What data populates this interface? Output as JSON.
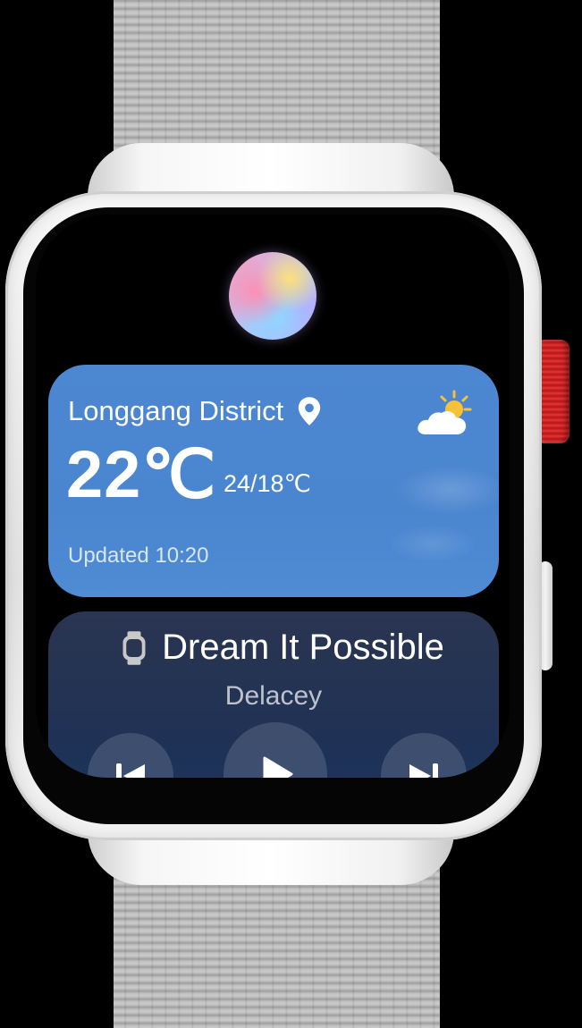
{
  "assistant": {
    "icon": "assistant-orb-icon"
  },
  "weather": {
    "location": "Longgang District",
    "temperature": "22℃",
    "range": "24/18℃",
    "updated": "Updated 10:20",
    "location_icon": "location-pin-icon",
    "condition_icon": "partly-cloudy-icon",
    "card_color": "#4a85cf"
  },
  "music": {
    "title": "Dream It Possible",
    "artist": "Delacey",
    "device_icon": "watch-icon",
    "controls": [
      "previous-track-icon",
      "play-icon",
      "next-track-icon"
    ],
    "card_color": "#1f3256"
  },
  "device": {
    "crown_color": "#d92b2b",
    "band_color": "#d6d6d6"
  }
}
